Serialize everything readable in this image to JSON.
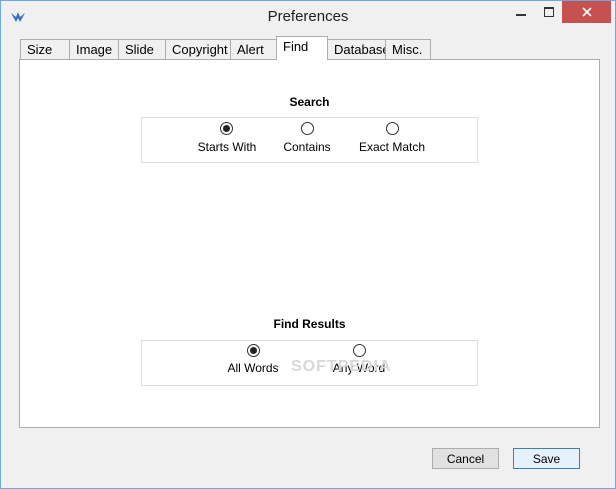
{
  "window": {
    "title": "Preferences"
  },
  "tabs": [
    {
      "label": "Size"
    },
    {
      "label": "Image"
    },
    {
      "label": "Slide"
    },
    {
      "label": "Copyright"
    },
    {
      "label": "Alert"
    },
    {
      "label": "Find"
    },
    {
      "label": "Database"
    },
    {
      "label": "Misc."
    }
  ],
  "active_tab": "Find",
  "search": {
    "title": "Search",
    "options": [
      {
        "label": "Starts With",
        "checked": true
      },
      {
        "label": "Contains",
        "checked": false
      },
      {
        "label": "Exact Match",
        "checked": false
      }
    ]
  },
  "find_results": {
    "title": "Find Results",
    "options": [
      {
        "label": "All Words",
        "checked": true
      },
      {
        "label": "Any Word",
        "checked": false
      }
    ]
  },
  "watermark": "SOFTPEDIA",
  "buttons": {
    "cancel": "Cancel",
    "save": "Save"
  },
  "icons": {
    "app": "app-logo-icon",
    "minimize": "minimize-icon",
    "maximize": "maximize-icon",
    "close": "close-icon"
  },
  "colors": {
    "close_button": "#c75050",
    "window_border": "#6fa8dc",
    "default_button_border": "#3c7fb1"
  }
}
